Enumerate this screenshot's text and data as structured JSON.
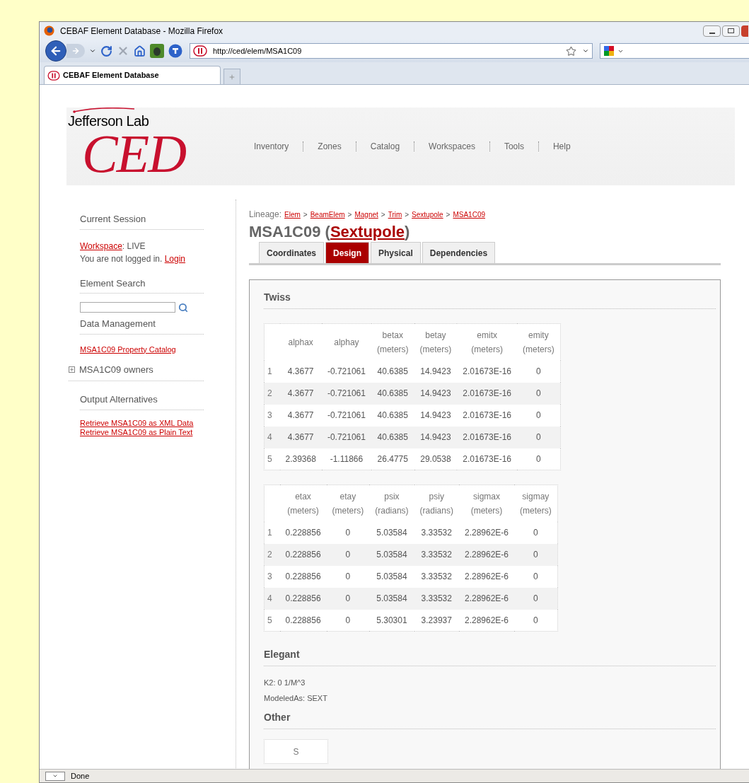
{
  "window": {
    "title": "CEBAF Element Database - Mozilla Firefox"
  },
  "address_bar": {
    "url": "http://ced/elem/MSA1C09"
  },
  "tabs": [
    {
      "label": "CEBAF Element Database",
      "selected": true
    }
  ],
  "header": {
    "logo_top": "Jefferson Lab",
    "logo_main": "CED",
    "nav": [
      "Inventory",
      "Zones",
      "Catalog",
      "Workspaces",
      "Tools",
      "Help"
    ]
  },
  "sidebar": {
    "session": {
      "heading": "Current Session",
      "workspace_link": "Workspace",
      "workspace_value": ": LIVE",
      "login_text": "You are not logged in.",
      "login_link": "Login"
    },
    "search": {
      "heading": "Element Search"
    },
    "data": {
      "heading": "Data Management",
      "link": "MSA1C09 Property Catalog",
      "owners": {
        "label": "MSA1C09 owners",
        "expanded": false
      }
    },
    "output": {
      "heading": "Output Alternatives",
      "links": [
        "Retrieve MSA1C09 as XML Data",
        "Retrieve MSA1C09 as Plain Text"
      ]
    }
  },
  "lineage": {
    "label": "Lineage:",
    "separator": ">",
    "items": [
      "Elem",
      "BeamElem",
      "Magnet",
      "Trim",
      "Sextupole",
      "MSA1C09"
    ]
  },
  "title": {
    "prefix": "MSA1C09 (",
    "link": "Sextupole",
    "suffix": ")"
  },
  "element_tabs": [
    {
      "label": "Coordinates",
      "selected": false
    },
    {
      "label": "Design",
      "selected": true
    },
    {
      "label": "Physical",
      "selected": false
    },
    {
      "label": "Dependencies",
      "selected": false
    }
  ],
  "twiss": {
    "heading": "Twiss",
    "tables": [
      {
        "columns": [
          {
            "name": "alphax"
          },
          {
            "name": "alphay"
          },
          {
            "name": "betax",
            "unit": "(meters)"
          },
          {
            "name": "betay",
            "unit": "(meters)"
          },
          {
            "name": "emitx",
            "unit": "(meters)"
          },
          {
            "name": "emity",
            "unit": "(meters)"
          }
        ],
        "rows": [
          {
            "index": "1",
            "cells": [
              "4.3677",
              "-0.721061",
              "40.6385",
              "14.9423",
              "2.01673E-16",
              "0"
            ]
          },
          {
            "index": "2",
            "cells": [
              "4.3677",
              "-0.721061",
              "40.6385",
              "14.9423",
              "2.01673E-16",
              "0"
            ]
          },
          {
            "index": "3",
            "cells": [
              "4.3677",
              "-0.721061",
              "40.6385",
              "14.9423",
              "2.01673E-16",
              "0"
            ]
          },
          {
            "index": "4",
            "cells": [
              "4.3677",
              "-0.721061",
              "40.6385",
              "14.9423",
              "2.01673E-16",
              "0"
            ]
          },
          {
            "index": "5",
            "cells": [
              "2.39368",
              "-1.11866",
              "26.4775",
              "29.0538",
              "2.01673E-16",
              "0"
            ]
          }
        ]
      },
      {
        "columns": [
          {
            "name": "etax",
            "unit": "(meters)"
          },
          {
            "name": "etay",
            "unit": "(meters)"
          },
          {
            "name": "psix",
            "unit": "(radians)"
          },
          {
            "name": "psiy",
            "unit": "(radians)"
          },
          {
            "name": "sigmax",
            "unit": "(meters)"
          },
          {
            "name": "sigmay",
            "unit": "(meters)"
          }
        ],
        "rows": [
          {
            "index": "1",
            "cells": [
              "0.228856",
              "0",
              "5.03584",
              "3.33532",
              "2.28962E-6",
              "0"
            ]
          },
          {
            "index": "2",
            "cells": [
              "0.228856",
              "0",
              "5.03584",
              "3.33532",
              "2.28962E-6",
              "0"
            ]
          },
          {
            "index": "3",
            "cells": [
              "0.228856",
              "0",
              "5.03584",
              "3.33532",
              "2.28962E-6",
              "0"
            ]
          },
          {
            "index": "4",
            "cells": [
              "0.228856",
              "0",
              "5.03584",
              "3.33532",
              "2.28962E-6",
              "0"
            ]
          },
          {
            "index": "5",
            "cells": [
              "0.228856",
              "0",
              "5.30301",
              "3.23937",
              "2.28962E-6",
              "0"
            ]
          }
        ]
      }
    ]
  },
  "elegant": {
    "heading": "Elegant",
    "lines": [
      "K2: 0 1/M^3",
      "ModeledAs: SEXT"
    ]
  },
  "other": {
    "heading": "Other",
    "columns": [
      "S"
    ]
  },
  "status_bar": {
    "text": "Done"
  }
}
